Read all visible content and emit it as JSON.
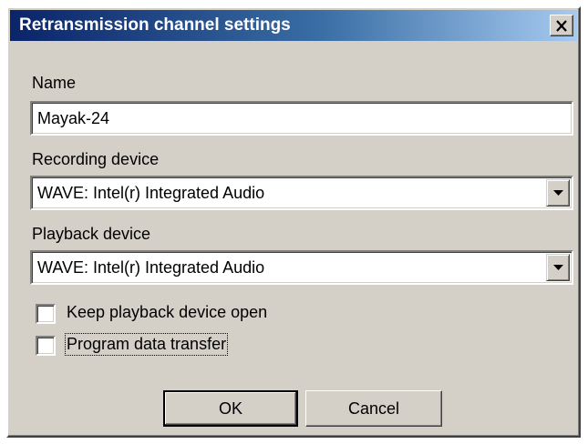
{
  "window": {
    "title": "Retransmission channel settings",
    "close_icon": "close-icon"
  },
  "form": {
    "name_label": "Name",
    "name_value": "Mayak-24",
    "recording_label": "Recording device",
    "recording_value": "WAVE: Intel(r) Integrated Audio",
    "playback_label": "Playback device",
    "playback_value": "WAVE: Intel(r) Integrated Audio",
    "keep_open_label": "Keep playback device open",
    "keep_open_checked": false,
    "program_transfer_label": "Program data transfer",
    "program_transfer_checked": false
  },
  "buttons": {
    "ok_label": "OK",
    "cancel_label": "Cancel"
  },
  "colors": {
    "titlebar_start": "#0a246a",
    "titlebar_end": "#a6caf0",
    "face": "#d4d0c8"
  }
}
